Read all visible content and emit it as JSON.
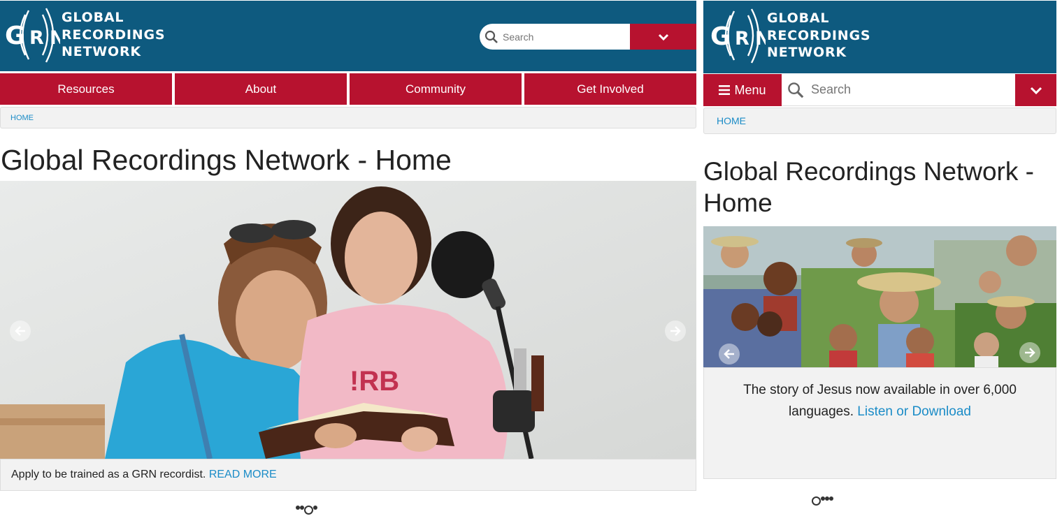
{
  "brand": {
    "line1": "GLOBAL",
    "line2": "RECORDINGS",
    "line3": "NETWORK",
    "mark": "G(R)N",
    "colors": {
      "header": "#0e5a7f",
      "accent": "#b7122f",
      "link": "#1b8cc7"
    }
  },
  "desktop": {
    "search": {
      "placeholder": "Search",
      "icon": "search-icon",
      "dropdown_icon": "chevron-down-icon"
    },
    "nav": [
      {
        "label": "Resources"
      },
      {
        "label": "About"
      },
      {
        "label": "Community"
      },
      {
        "label": "Get Involved"
      }
    ],
    "breadcrumb": "HOME",
    "title": "Global Recordings Network - Home",
    "slide": {
      "caption": "Apply to be trained as a GRN recordist.",
      "link": "READ MORE",
      "image": "two young women holding a book next to a microphone"
    },
    "dots": {
      "count": 4,
      "active_index": 2
    }
  },
  "mobile": {
    "menu_label": "Menu",
    "search": {
      "placeholder": "Search"
    },
    "breadcrumb": "HOME",
    "title": "Global Recordings Network - Home",
    "slide": {
      "caption": "The story of Jesus now available in over 6,000 languages.",
      "link": "Listen or Download",
      "image": "collage of people from many cultures"
    },
    "dots": {
      "count": 4,
      "active_index": 0
    }
  }
}
